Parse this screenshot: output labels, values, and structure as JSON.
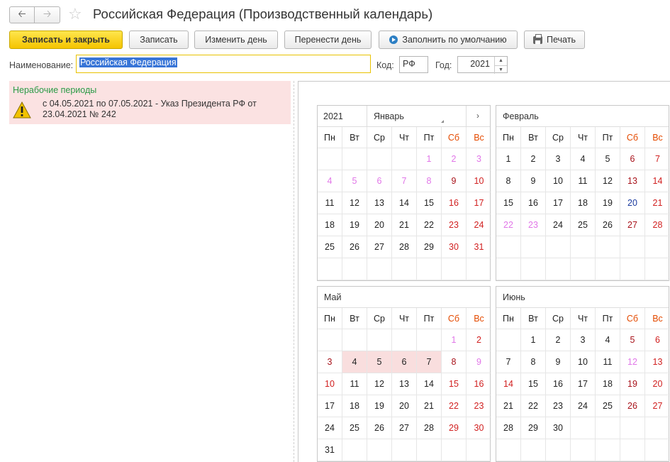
{
  "window": {
    "title": "Российская Федерация (Производственный календарь)"
  },
  "toolbar": {
    "save_close": "Записать и закрыть",
    "save": "Записать",
    "change_day": "Изменить день",
    "move_day": "Перенести день",
    "fill_default": "Заполнить по умолчанию",
    "print": "Печать"
  },
  "form": {
    "name_label": "Наименование:",
    "name_value": "Российская Федерация",
    "code_label": "Код:",
    "code_value": "РФ",
    "year_label": "Год:",
    "year_value": "2021"
  },
  "nonwork": {
    "title": "Нерабочие периоды",
    "text": "с 04.05.2021 по 07.05.2021 - Указ Президента РФ от 23.04.2021 № 242"
  },
  "colors": {
    "weekend_red": "#d12020",
    "holiday_darkred": "#a8121a",
    "preholiday_pink": "#e176e8",
    "shortened_blue": "#1a3a9e",
    "nonwork_bg": "#f9dede",
    "primary_button": "#f5c400"
  },
  "calendar": {
    "year": "2021",
    "weekdays": [
      "Пн",
      "Вт",
      "Ср",
      "Чт",
      "Пт",
      "Сб",
      "Вс"
    ],
    "months": [
      {
        "name": "Январь",
        "offset": 4,
        "days": 31,
        "styles": {
          "1": "pink",
          "2": "pink",
          "3": "pink",
          "4": "pink",
          "5": "pink",
          "6": "pink",
          "7": "pink",
          "8": "pink",
          "9": "darkred",
          "10": "red",
          "16": "red",
          "17": "red",
          "23": "red",
          "24": "red",
          "30": "red",
          "31": "red"
        }
      },
      {
        "name": "Февраль",
        "offset": 0,
        "days": 28,
        "styles": {
          "6": "darkred",
          "7": "red",
          "13": "darkred",
          "14": "red",
          "20": "blue",
          "21": "red",
          "22": "pink",
          "23": "pink",
          "27": "darkred",
          "28": "red"
        }
      },
      {
        "name": "Май",
        "offset": 5,
        "days": 31,
        "styles": {
          "1": "pink",
          "2": "red",
          "3": "darkred",
          "4": "nonwork",
          "5": "nonwork",
          "6": "nonwork",
          "7": "nonwork",
          "8": "darkred",
          "9": "pink",
          "10": "red",
          "15": "red",
          "16": "red",
          "22": "red",
          "23": "red",
          "29": "red",
          "30": "red"
        }
      },
      {
        "name": "Июнь",
        "offset": 1,
        "days": 30,
        "styles": {
          "5": "darkred",
          "6": "red",
          "12": "pink",
          "13": "red",
          "14": "red",
          "19": "darkred",
          "20": "red",
          "26": "darkred",
          "27": "red"
        }
      }
    ]
  }
}
